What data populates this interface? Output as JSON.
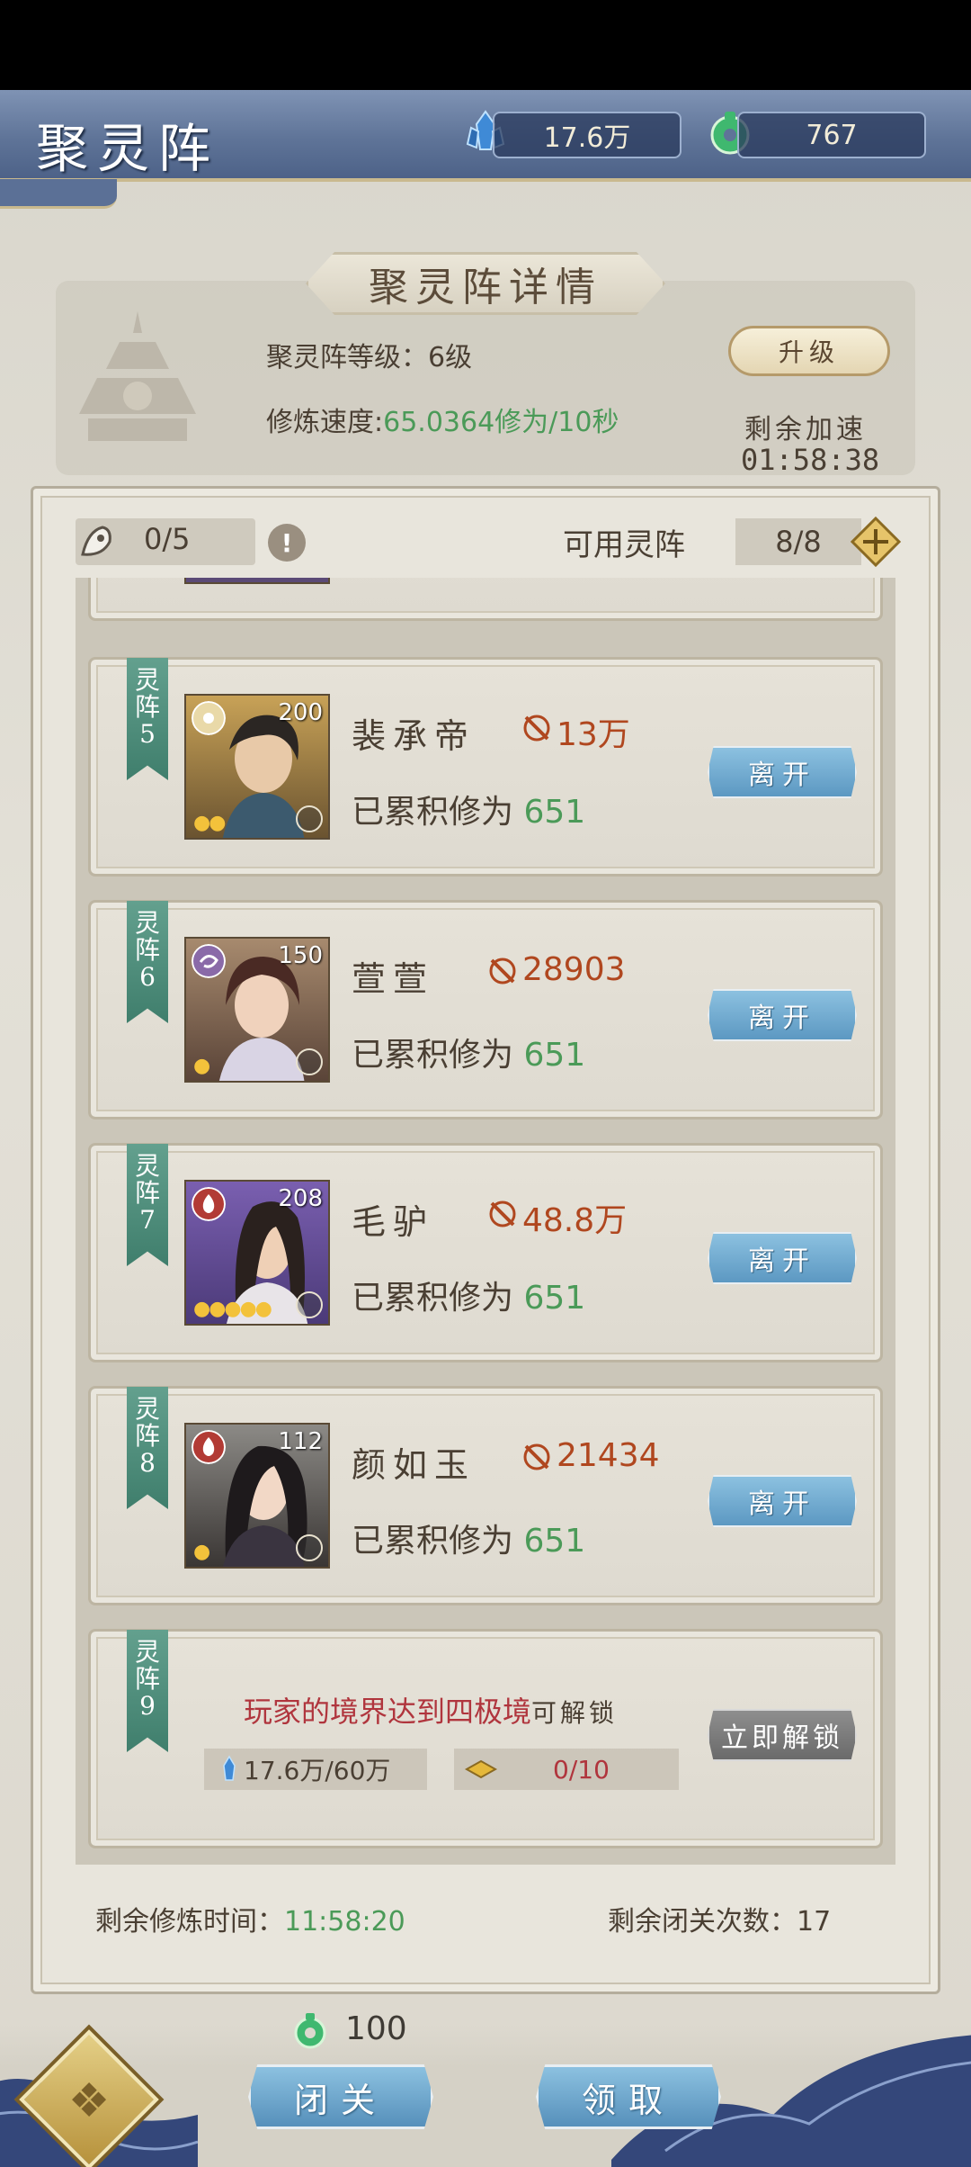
{
  "header": {
    "title": "聚灵阵",
    "crystal_amount": "17.6万",
    "jade_amount": "767",
    "crystal_icon": "blue-crystal-icon",
    "jade_icon": "green-jade-icon"
  },
  "detail": {
    "title": "聚灵阵详情",
    "level_label": "聚灵阵等级：",
    "level_value": "6级",
    "speed_label": "修炼速度:",
    "speed_value": "65.0364修为/10秒",
    "upgrade_label": "升级",
    "boost_label": "剩余加速",
    "boost_time": "01:58:38"
  },
  "panel": {
    "slot_count": "0/5",
    "available_label": "可用灵阵",
    "available_value": "8/8"
  },
  "cards": [
    {
      "ribbon": "灵阵5",
      "level": "200",
      "name": "裴承帝",
      "power": "13万",
      "accum_label": "已累积修为 ",
      "accum_value": "651",
      "action": "离开",
      "element": "light",
      "stars": 2
    },
    {
      "ribbon": "灵阵6",
      "level": "150",
      "name": "萱萱",
      "power": "28903",
      "accum_label": "已累积修为 ",
      "accum_value": "651",
      "action": "离开",
      "element": "wind",
      "stars": 1
    },
    {
      "ribbon": "灵阵7",
      "level": "208",
      "name": "毛驴",
      "power": "48.8万",
      "accum_label": "已累积修为 ",
      "accum_value": "651",
      "action": "离开",
      "element": "fire",
      "stars": 5
    },
    {
      "ribbon": "灵阵8",
      "level": "112",
      "name": "颜如玉",
      "power": "21434",
      "accum_label": "已累积修为 ",
      "accum_value": "651",
      "action": "离开",
      "element": "fire",
      "stars": 1
    }
  ],
  "locked_card": {
    "ribbon": "灵阵9",
    "requirement": "玩家的境界达到四极境",
    "requirement_suffix": "可解锁",
    "crystal_progress": "17.6万/60万",
    "item_progress": "0/10",
    "unlock_label": "立即解锁"
  },
  "footer": {
    "time_label": "剩余修炼时间：",
    "time_value": "11:58:20",
    "closure_label": "剩余闭关次数：",
    "closure_value": "17"
  },
  "bottom": {
    "jade_cost": "100",
    "closure_button": "闭关",
    "claim_button": "领取"
  },
  "colors": {
    "accent_green": "#4b9a58",
    "power_red": "#b0471f",
    "button_blue": "#5c98c2",
    "ribbon_green": "#3f7e6c"
  }
}
